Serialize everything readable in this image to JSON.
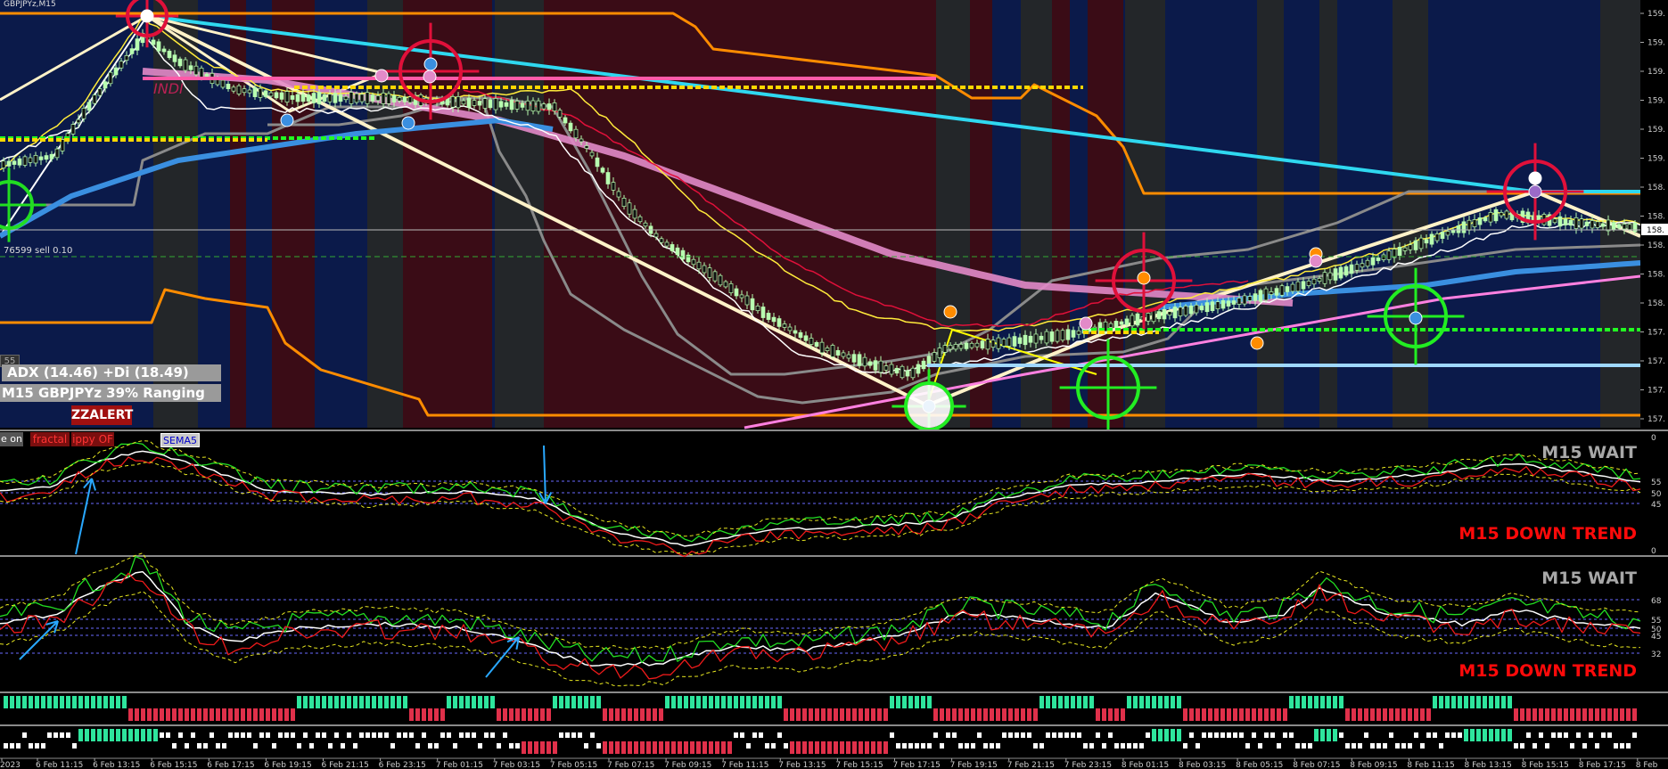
{
  "window": {
    "symbol_title": "GBPJPYz,M15"
  },
  "info": {
    "adx_label": "ADX (14.46)   +Di (18.49)",
    "ranging_label": "M15 GBPJPYz 39% Ranging",
    "order_line": "76599 sell 0.10",
    "ind_watermark": "INDI"
  },
  "buttons": {
    "zzalert": "ZZALERT",
    "fractal": "fractal",
    "zippy": "ippy OF",
    "sema": "SEMA5",
    "eon": "e on",
    "side_tab": "55"
  },
  "panels": {
    "osc1": {
      "wait_label": "M15 WAIT",
      "trend_label": "M15 DOWN TREND",
      "levels": [
        "0",
        "55",
        "50",
        "45",
        "0"
      ]
    },
    "osc2": {
      "wait_label": "M15 WAIT",
      "trend_label": "M15 DOWN TREND",
      "levels": [
        "68",
        "55",
        "50",
        "45",
        "32"
      ]
    }
  },
  "price_axis": {
    "labels": [
      "159.",
      "159.",
      "159.",
      "159.",
      "159.",
      "159.",
      "158.",
      "158.",
      "158.",
      "158.",
      "158.",
      "157.",
      "157.",
      "157.",
      "157."
    ],
    "current_price": "158.",
    "background": "#000000"
  },
  "time_axis": {
    "labels": [
      "2023",
      "6 Feb 11:15",
      "6 Feb 13:15",
      "6 Feb 15:15",
      "6 Feb 17:15",
      "6 Feb 19:15",
      "6 Feb 21:15",
      "6 Feb 23:15",
      "7 Feb 01:15",
      "7 Feb 03:15",
      "7 Feb 05:15",
      "7 Feb 07:15",
      "7 Feb 09:15",
      "7 Feb 11:15",
      "7 Feb 13:15",
      "7 Feb 15:15",
      "7 Feb 17:15",
      "7 Feb 19:15",
      "7 Feb 21:15",
      "7 Feb 23:15",
      "8 Feb 01:15",
      "8 Feb 03:15",
      "8 Feb 05:15",
      "8 Feb 07:15",
      "8 Feb 09:15",
      "8 Feb 11:15",
      "8 Feb 13:15",
      "8 Feb 15:15",
      "8 Feb 17:15",
      "8 Feb"
    ]
  },
  "colors": {
    "bg_blue": "#0b1a4a",
    "bg_red": "#3a0c16",
    "bg_gray": "#232629",
    "candle": "#b8ffb0",
    "orange": "#ff8c00",
    "cyan": "#2fd8f0",
    "pink": "#e28ac8",
    "blue_ma": "#3a8fe0",
    "cream": "#fff2c8",
    "histo_green": "#2ee59d",
    "histo_red": "#e0304a",
    "status_wait": "#a8a8a8",
    "status_trend": "#ff0a0a"
  }
}
